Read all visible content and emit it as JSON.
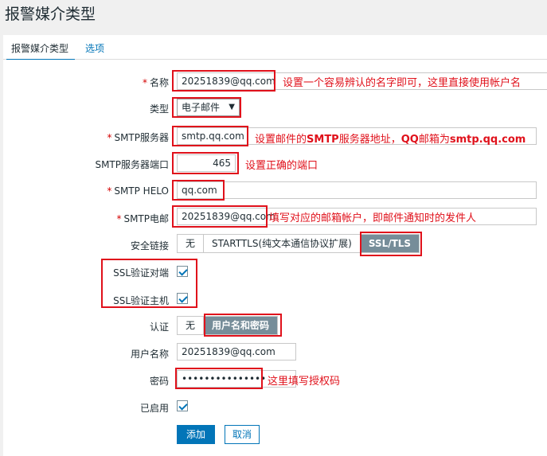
{
  "page": {
    "title": "报警媒介类型"
  },
  "tabs": [
    {
      "label": "报警媒介类型"
    },
    {
      "label": "选项"
    }
  ],
  "form": {
    "name": {
      "label": "名称",
      "value": "20251839@qq.com"
    },
    "type": {
      "label": "类型",
      "value": "电子邮件"
    },
    "smtp_server": {
      "label": "SMTP服务器",
      "value": "smtp.qq.com"
    },
    "smtp_port": {
      "label": "SMTP服务器端口",
      "value": "465"
    },
    "smtp_helo": {
      "label": "SMTP HELO",
      "value": "qq.com"
    },
    "smtp_email": {
      "label": "SMTP电邮",
      "value": "20251839@qq.com"
    },
    "security": {
      "label": "安全链接",
      "options": [
        "无",
        "STARTTLS(纯文本通信协议扩展)",
        "SSL/TLS"
      ],
      "selected": "SSL/TLS"
    },
    "ssl_verify_peer": {
      "label": "SSL验证对端",
      "checked": true
    },
    "ssl_verify_host": {
      "label": "SSL验证主机",
      "checked": true
    },
    "auth": {
      "label": "认证",
      "options": [
        "无",
        "用户名和密码"
      ],
      "selected": "用户名和密码"
    },
    "username": {
      "label": "用户名称",
      "value": "20251839@qq.com"
    },
    "password": {
      "label": "密码",
      "value": "•••••••••••••••"
    },
    "enabled": {
      "label": "已启用",
      "checked": true
    }
  },
  "buttons": {
    "add": "添加",
    "cancel": "取消"
  },
  "annotations": {
    "name_note": "设置一个容易辨认的名字即可，这里直接使用帐户名",
    "smtp_note_prefix": "设置邮件的",
    "smtp_note_bold1": "SMTP",
    "smtp_note_mid": "服务器地址，",
    "smtp_note_bold2": "QQ",
    "smtp_note_mid2": "邮箱为",
    "smtp_note_bold3": "smtp.qq.com",
    "port_note": "设置正确的端口",
    "email_note": "填写对应的邮箱帐户，即邮件通知时的发件人",
    "password_note": "这里填写授权码"
  },
  "colors": {
    "accent": "#0275b8",
    "annotation": "#e0111b",
    "selected_segment": "#768d99"
  }
}
